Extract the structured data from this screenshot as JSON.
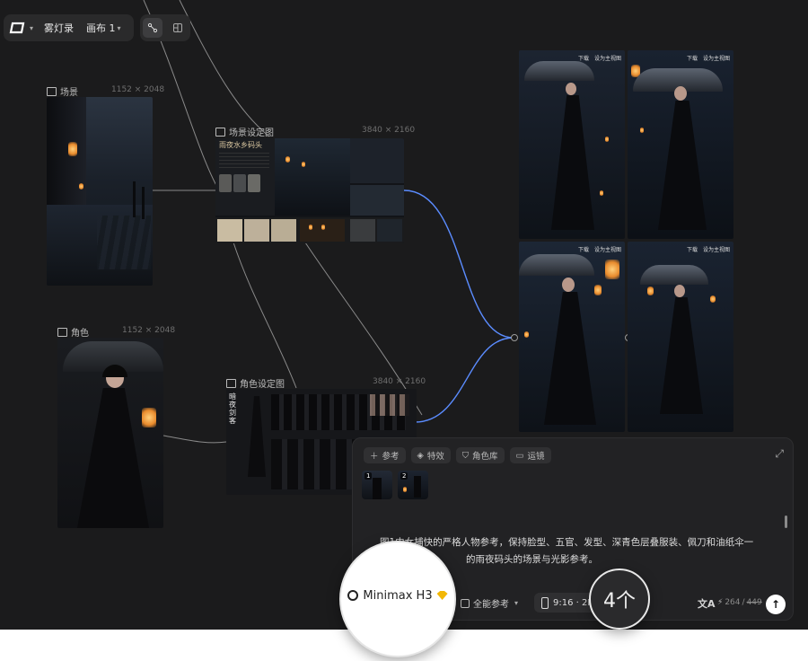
{
  "toolbar": {
    "project_name": "雾灯录",
    "canvas_name": "画布 1"
  },
  "nodes": {
    "scene": {
      "label": "场景",
      "dims": "1152 × 2048"
    },
    "scene_setting": {
      "label": "场景设定图",
      "dims": "3840 × 2160",
      "poster_title": "雨夜水乡码头"
    },
    "character": {
      "label": "角色",
      "dims": "1152 × 2048"
    },
    "character_setting": {
      "label": "角色设定图",
      "dims": "3840 × 2160",
      "poster_title": "暗夜剑客"
    }
  },
  "results": {
    "download": "下载",
    "set_main": "设为主视图"
  },
  "panel": {
    "chips": [
      "参考",
      "特效",
      "角色库",
      "运镜"
    ],
    "thumb_1": "1",
    "thumb_2": "2",
    "prompt_line_1": "图1中女捕快的严格人物参考，保持脸型、五官、发型、深青色层叠服装、佩刀和油纸伞一",
    "prompt_line_2": "的雨夜码头的场景与光影参考。",
    "model_name": "Minimax H3",
    "ref_mode": "全能参考",
    "ratio": "9:16 · 2K",
    "count": "4个",
    "credits_current": "264",
    "credits_total": "449"
  },
  "colors": {
    "canvas_bg": "#1b1b1c",
    "accent_blue": "#5b8cff",
    "badge_gold": "#f2b705"
  }
}
